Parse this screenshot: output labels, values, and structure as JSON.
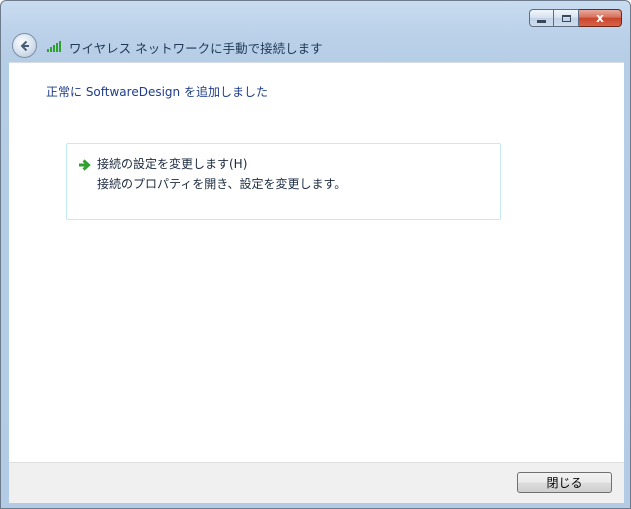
{
  "window": {
    "title": "ワイヤレス ネットワークに手動で接続します",
    "controls": {
      "minimize": "",
      "maximize": "",
      "close": "x"
    }
  },
  "content": {
    "success_message": "正常に SoftwareDesign を追加しました",
    "option": {
      "title": "接続の設定を変更します(H)",
      "description": "接続のプロパティを開き、設定を変更します。"
    }
  },
  "footer": {
    "close_label": "閉じる"
  },
  "icons": {
    "back": "back-arrow-icon",
    "network": "wireless-signal-icon",
    "option": "green-arrow-icon"
  },
  "colors": {
    "link_text": "#1f3d8a",
    "box_border": "#c4eaf2",
    "arrow_green": "#2ea12e"
  }
}
